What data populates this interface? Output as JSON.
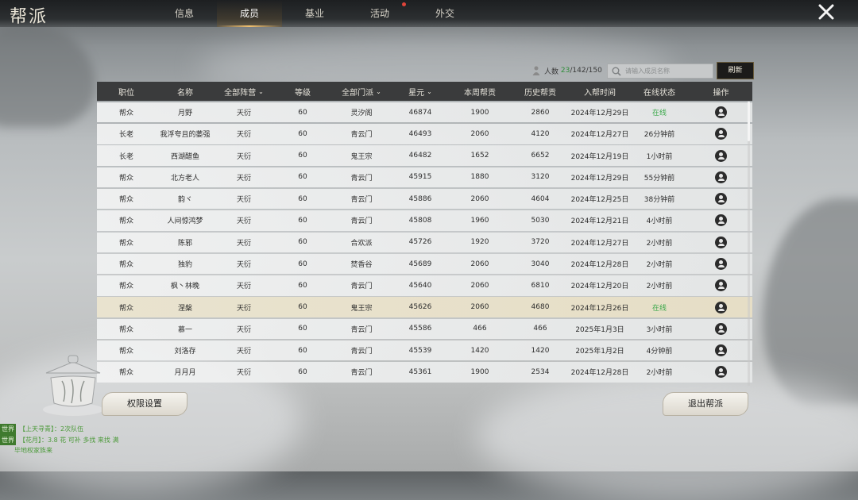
{
  "header": {
    "title": "帮派",
    "tabs": [
      {
        "label": "信息",
        "active": false,
        "badge": false
      },
      {
        "label": "成员",
        "active": true,
        "badge": false
      },
      {
        "label": "基业",
        "active": false,
        "badge": false
      },
      {
        "label": "活动",
        "active": false,
        "badge": true
      },
      {
        "label": "外交",
        "active": false,
        "badge": false
      }
    ],
    "close_icon": "close-x-icon"
  },
  "members_info": {
    "label": "人数",
    "online": "23",
    "separator1": "/",
    "current": "142",
    "separator2": "/",
    "max": "150",
    "search_placeholder": "请输入成员名称",
    "refresh_label": "刷新"
  },
  "table": {
    "columns": [
      {
        "label": "职位",
        "sortable": false
      },
      {
        "label": "名称",
        "sortable": false
      },
      {
        "label": "全部阵营",
        "sortable": true
      },
      {
        "label": "等级",
        "sortable": false
      },
      {
        "label": "全部门派",
        "sortable": true
      },
      {
        "label": "星元",
        "sortable": true
      },
      {
        "label": "本周帮贡",
        "sortable": false
      },
      {
        "label": "历史帮贡",
        "sortable": false
      },
      {
        "label": "入帮时间",
        "sortable": false
      },
      {
        "label": "在线状态",
        "sortable": false
      },
      {
        "label": "操作",
        "sortable": false
      }
    ],
    "rows": [
      {
        "role": "帮众",
        "name": "月野",
        "camp": "天衍",
        "level": "60",
        "sect": "灵汐阁",
        "star": "46874",
        "weekly": "1900",
        "history": "2860",
        "joined": "2024年12月29日",
        "status": "在线",
        "online": true,
        "highlight": false
      },
      {
        "role": "长老",
        "name": "我浮夸且的萎强",
        "camp": "天衍",
        "level": "60",
        "sect": "青云门",
        "star": "46493",
        "weekly": "2060",
        "history": "4120",
        "joined": "2024年12月27日",
        "status": "26分钟前",
        "online": false,
        "highlight": false
      },
      {
        "role": "长老",
        "name": "西湖醋鱼",
        "camp": "天衍",
        "level": "60",
        "sect": "鬼王宗",
        "star": "46482",
        "weekly": "1652",
        "history": "6652",
        "joined": "2024年12月19日",
        "status": "1小时前",
        "online": false,
        "highlight": false
      },
      {
        "role": "帮众",
        "name": "北方老人",
        "camp": "天衍",
        "level": "60",
        "sect": "青云门",
        "star": "45915",
        "weekly": "1880",
        "history": "3120",
        "joined": "2024年12月29日",
        "status": "55分钟前",
        "online": false,
        "highlight": false
      },
      {
        "role": "帮众",
        "name": "韵ヾ",
        "camp": "天衍",
        "level": "60",
        "sect": "青云门",
        "star": "45886",
        "weekly": "2060",
        "history": "4604",
        "joined": "2024年12月25日",
        "status": "38分钟前",
        "online": false,
        "highlight": false
      },
      {
        "role": "帮众",
        "name": "人间惊鸿梦",
        "camp": "天衍",
        "level": "60",
        "sect": "青云门",
        "star": "45808",
        "weekly": "1960",
        "history": "5030",
        "joined": "2024年12月21日",
        "status": "4小时前",
        "online": false,
        "highlight": false
      },
      {
        "role": "帮众",
        "name": "陈邪",
        "camp": "天衍",
        "level": "60",
        "sect": "合欢派",
        "star": "45726",
        "weekly": "1920",
        "history": "3720",
        "joined": "2024年12月27日",
        "status": "2小时前",
        "online": false,
        "highlight": false
      },
      {
        "role": "帮众",
        "name": "独豹",
        "camp": "天衍",
        "level": "60",
        "sect": "焚香谷",
        "star": "45689",
        "weekly": "2060",
        "history": "3040",
        "joined": "2024年12月28日",
        "status": "2小时前",
        "online": false,
        "highlight": false
      },
      {
        "role": "帮众",
        "name": "枫丶林晚",
        "camp": "天衍",
        "level": "60",
        "sect": "青云门",
        "star": "45640",
        "weekly": "2060",
        "history": "6810",
        "joined": "2024年12月20日",
        "status": "2小时前",
        "online": false,
        "highlight": false
      },
      {
        "role": "帮众",
        "name": "涅槃",
        "camp": "天衍",
        "level": "60",
        "sect": "鬼王宗",
        "star": "45626",
        "weekly": "2060",
        "history": "4680",
        "joined": "2024年12月26日",
        "status": "在线",
        "online": true,
        "highlight": true
      },
      {
        "role": "帮众",
        "name": "慕一",
        "camp": "天衍",
        "level": "60",
        "sect": "青云门",
        "star": "45586",
        "weekly": "466",
        "history": "466",
        "joined": "2025年1月3日",
        "status": "3小时前",
        "online": false,
        "highlight": false
      },
      {
        "role": "帮众",
        "name": "刘洛存",
        "camp": "天衍",
        "level": "60",
        "sect": "青云门",
        "star": "45539",
        "weekly": "1420",
        "history": "1420",
        "joined": "2025年1月2日",
        "status": "4分钟前",
        "online": false,
        "highlight": false
      },
      {
        "role": "帮众",
        "name": "月月月",
        "camp": "天衍",
        "level": "60",
        "sect": "青云门",
        "star": "45361",
        "weekly": "1900",
        "history": "2534",
        "joined": "2024年12月28日",
        "status": "2小时前",
        "online": false,
        "highlight": false
      }
    ],
    "action_icon": "person-profile-icon"
  },
  "buttons": {
    "permissions": "权限设置",
    "exit": "退出帮派"
  },
  "chat": {
    "lines": [
      {
        "tag": "世界",
        "text": "【上天寻青】：2次队伍"
      },
      {
        "tag": "世界",
        "text": "【花月】：3.8 花 可补 多找 来找 满"
      },
      {
        "tag": "",
        "text": "毕地权家族来"
      }
    ]
  },
  "colors": {
    "online_green": "#3aa84a",
    "highlight_row": "#e9e3cf",
    "header_bg": "#3a3b3c"
  }
}
